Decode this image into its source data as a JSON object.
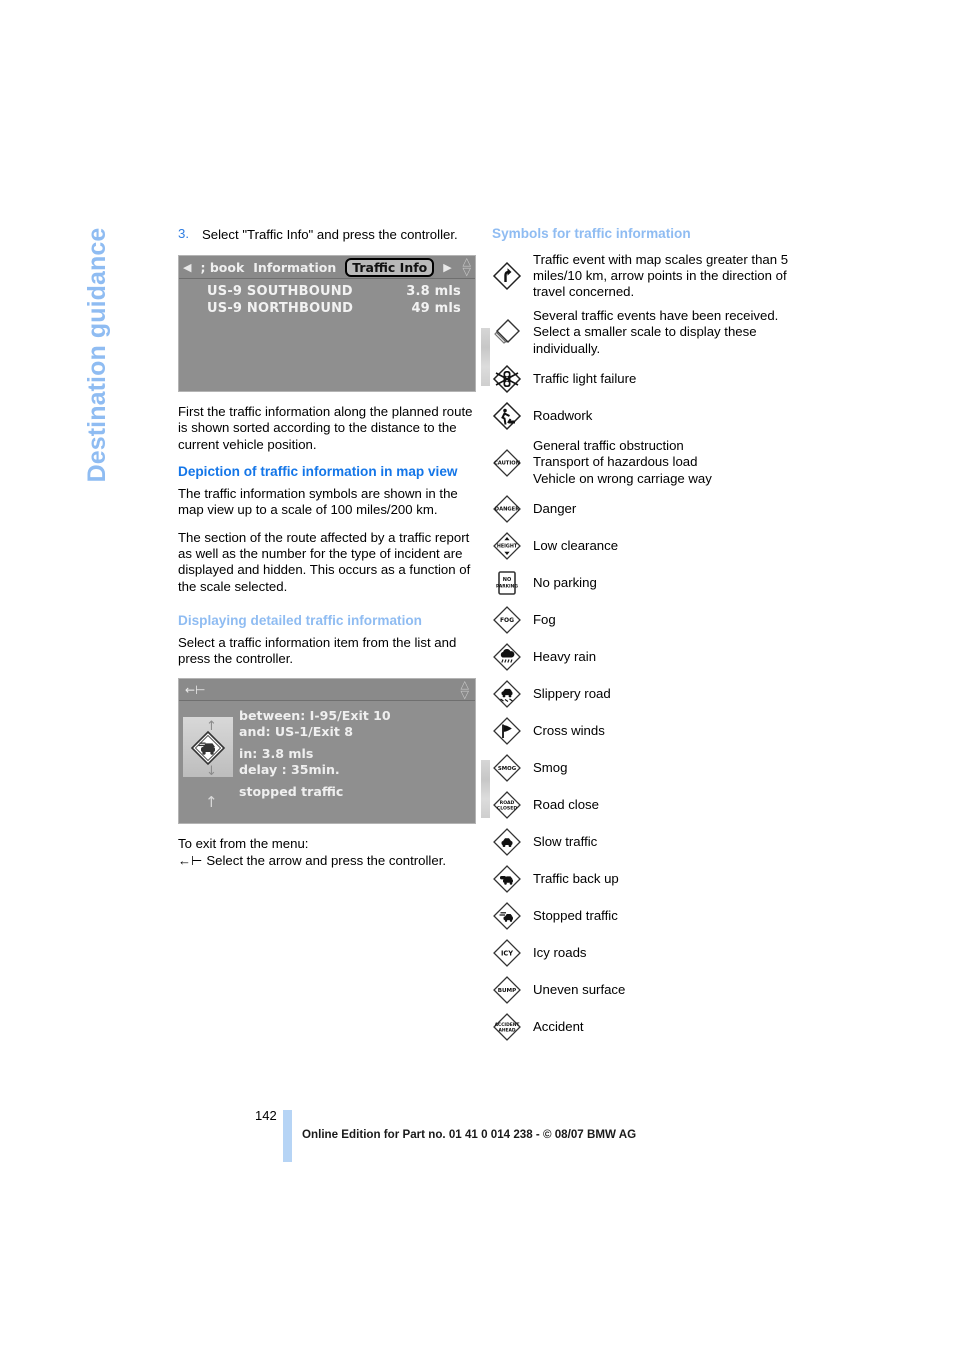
{
  "running_head": "Destination guidance",
  "left_column": {
    "step": {
      "number": "3.",
      "text": "Select \"Traffic Info\" and press the controller."
    },
    "figure1": {
      "nav": {
        "prev_icon": "◀",
        "crumb1": "; book",
        "crumb2": "Information",
        "selected": "Traffic Info",
        "next_icon": "▶"
      },
      "rows": [
        {
          "name": "US-9 SOUTHBOUND",
          "distance": "3.8 mls"
        },
        {
          "name": "US-9 NORTHBOUND",
          "distance": "49 mls"
        }
      ]
    },
    "intro_paragraph": "First the traffic information along the planned route is shown sorted according to the distance to the current vehicle position.",
    "heading_map_view": "Depiction of traffic information in map view",
    "paragraph_map_1": "The traffic information symbols are shown in the map view up to a scale of 100 miles/200 km.",
    "paragraph_map_2": "The section of the route affected by a traffic report as well as the number for the type of incident are displayed and hidden. This occurs as a function of the scale selected.",
    "heading_detailed": "Displaying detailed traffic information",
    "paragraph_detailed": "Select a traffic information item from the list and press the controller.",
    "figure2": {
      "between_label": "between: I-95/Exit 10",
      "and_label": "and: US-1/Exit 8",
      "in_label": "in: 3.8 mls",
      "delay_label": "delay : 35min.",
      "status_label": "stopped traffic"
    },
    "exit_intro": "To exit from the menu:",
    "exit_instruction": "Select the arrow and press the controller."
  },
  "right_column": {
    "heading": "Symbols for traffic information",
    "symbols": [
      {
        "icon": "traffic-event-arrow-icon",
        "label": "Traffic event with map scales greater than 5 miles/10 km, arrow points in the direction of travel concerned."
      },
      {
        "icon": "several-events-stack-icon",
        "label": "Several traffic events have been received. Select a smaller scale to display these individually."
      },
      {
        "icon": "traffic-light-failure-icon",
        "label": "Traffic light failure"
      },
      {
        "icon": "roadwork-icon",
        "label": "Roadwork"
      },
      {
        "icon": "caution-icon",
        "label": "General traffic obstruction\nTransport of hazardous load\nVehicle on wrong carriage way"
      },
      {
        "icon": "danger-icon",
        "label": "Danger"
      },
      {
        "icon": "low-clearance-icon",
        "label": "Low clearance"
      },
      {
        "icon": "no-parking-icon",
        "label": "No parking"
      },
      {
        "icon": "fog-icon",
        "label": "Fog"
      },
      {
        "icon": "heavy-rain-icon",
        "label": "Heavy rain"
      },
      {
        "icon": "slippery-road-icon",
        "label": "Slippery road"
      },
      {
        "icon": "cross-winds-icon",
        "label": "Cross winds"
      },
      {
        "icon": "smog-icon",
        "label": "Smog"
      },
      {
        "icon": "road-close-icon",
        "label": "Road close"
      },
      {
        "icon": "slow-traffic-icon",
        "label": "Slow traffic"
      },
      {
        "icon": "traffic-back-up-icon",
        "label": "Traffic back up"
      },
      {
        "icon": "stopped-traffic-icon",
        "label": "Stopped traffic"
      },
      {
        "icon": "icy-roads-icon",
        "label": "Icy roads"
      },
      {
        "icon": "uneven-surface-icon",
        "label": "Uneven surface"
      },
      {
        "icon": "accident-icon",
        "label": "Accident"
      }
    ],
    "icon_texts": {
      "caution": "CAUTION",
      "danger": "DANGER",
      "height": "HEIGHT",
      "no_parking_line1": "NO",
      "no_parking_line2": "PARKING",
      "fog": "FOG",
      "smog": "SMOG",
      "road_close_line1": "ROAD",
      "road_close_line2": "CLOSED",
      "icy": "ICY",
      "bump": "BUMP",
      "accident_line1": "ACCIDENT",
      "accident_line2": "AHEAD"
    }
  },
  "footer": {
    "page_number": "142",
    "imprint": "Online Edition for Part no. 01 41 0 014 238 - © 08/07 BMW AG"
  },
  "colors": {
    "heading_strong": "#1476e8",
    "heading_light": "#8fbcf2",
    "running_head": "#8fbcf2",
    "step_number": "#2f7de1",
    "footer_bar": "#b6d4f5"
  }
}
